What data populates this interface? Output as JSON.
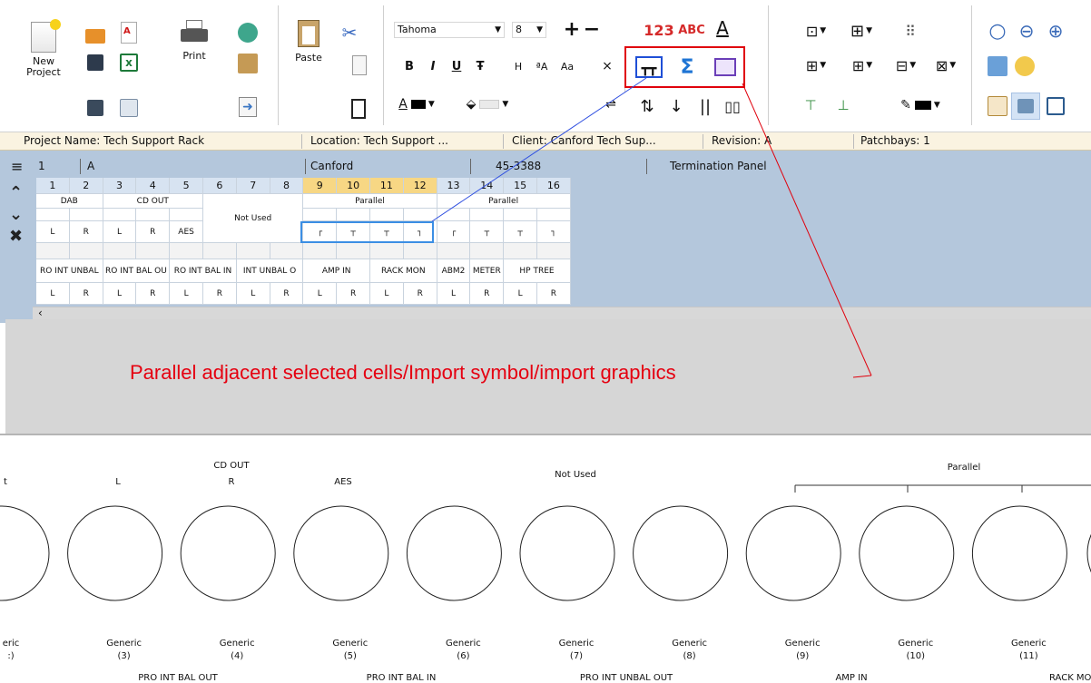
{
  "toolbar": {
    "new_project_label": "New Project",
    "print_label": "Print",
    "paste_label": "Paste",
    "font_name": "Tahoma",
    "font_size": "8",
    "bold": "B",
    "italic": "I",
    "underline": "U",
    "strike": "Ŧ",
    "case_upper": "H",
    "case_mixed": "ªA",
    "case_lower": "Aa",
    "num_icon_text": "123",
    "abc_icon_text": "ABC",
    "colors": {
      "accent_red": "#e0000c",
      "selection_blue": "#3b8ee4",
      "parallel_gold": "#f7d784"
    }
  },
  "infobar": {
    "project_name": "Project Name: Tech Support Rack",
    "location": "Location: Tech Support ...",
    "client": "Client: Canford Tech Sup...",
    "revision": "Revision: A",
    "patchbays": "Patchbays: 1"
  },
  "grid_header": {
    "index": "1",
    "row": "A",
    "manufacturer": "Canford",
    "part": "45-3388",
    "type": "Termination Panel"
  },
  "grid": {
    "columns": [
      "1",
      "2",
      "3",
      "4",
      "5",
      "6",
      "7",
      "8",
      "9",
      "10",
      "11",
      "12",
      "13",
      "14",
      "15",
      "16"
    ],
    "top_groups": [
      {
        "text": "DAB"
      },
      {
        "text": "CD OUT"
      },
      {
        "text": "Not Used"
      },
      {
        "text": "Parallel"
      },
      {
        "text": "Parallel"
      }
    ],
    "top_channels": [
      "L",
      "R",
      "L",
      "R",
      "AES",
      "",
      "",
      "",
      "┌",
      "┬",
      "┬",
      "┐",
      "┌",
      "┬",
      "┬",
      "┐"
    ],
    "bottom_groups": [
      {
        "text": "RO INT UNBAL"
      },
      {
        "text": "RO INT BAL OU"
      },
      {
        "text": "RO INT BAL IN"
      },
      {
        "text": "INT UNBAL O"
      },
      {
        "text": "AMP  IN"
      },
      {
        "text": "RACK MON"
      },
      {
        "text": "ABM2"
      },
      {
        "text": "METER"
      },
      {
        "text": "HP TREE"
      }
    ],
    "bottom_channels": [
      "L",
      "R",
      "L",
      "R",
      "L",
      "R",
      "L",
      "R",
      "L",
      "R",
      "L",
      "R",
      "L",
      "R",
      "L",
      "R"
    ]
  },
  "annotation": "Parallel adjacent selected cells/Import symbol/import graphics",
  "preview": {
    "top_labels": {
      "cd_out": "CD OUT",
      "not_used": "Not Used",
      "parallel": "Parallel",
      "l": "L",
      "r": "R",
      "aes": "AES",
      "cut": "t"
    },
    "jacks": [
      {
        "name": "eric",
        "num": ":)"
      },
      {
        "name": "Generic",
        "num": "(3)"
      },
      {
        "name": "Generic",
        "num": "(4)"
      },
      {
        "name": "Generic",
        "num": "(5)"
      },
      {
        "name": "Generic",
        "num": "(6)"
      },
      {
        "name": "Generic",
        "num": "(7)"
      },
      {
        "name": "Generic",
        "num": "(8)"
      },
      {
        "name": "Generic",
        "num": "(9)"
      },
      {
        "name": "Generic",
        "num": "(10)"
      },
      {
        "name": "Generic",
        "num": "(11)"
      }
    ],
    "bottom_labels": [
      "PRO INT BAL OUT",
      "PRO INT BAL IN",
      "PRO INT UNBAL OUT",
      "AMP  IN",
      "RACK MO"
    ]
  }
}
